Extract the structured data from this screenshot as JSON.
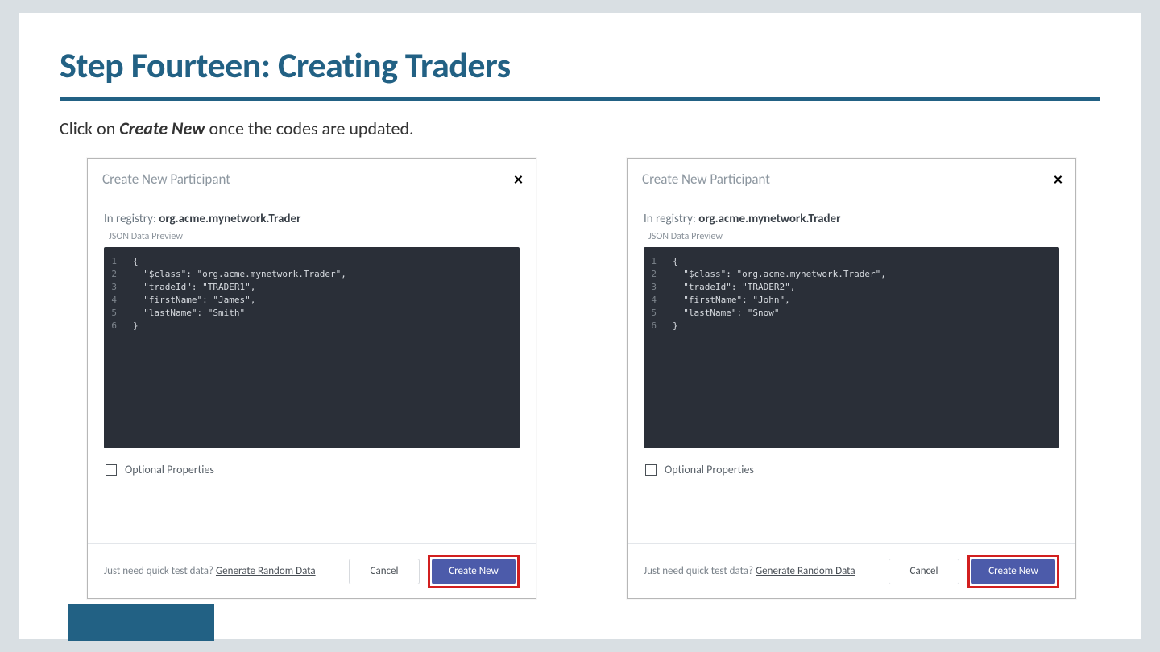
{
  "slide": {
    "title": "Step Fourteen: Creating Traders",
    "instruction_prefix": "Click on ",
    "instruction_bold": "Create New",
    "instruction_suffix": " once the codes are updated."
  },
  "dialog_shared": {
    "title": "Create New Participant",
    "registry_prefix": "In registry: ",
    "registry_name": "org.acme.mynetwork.Trader",
    "json_preview_label": "JSON Data Preview",
    "optional_label": "Optional Properties",
    "quick_prefix": "Just need quick test data? ",
    "generate_link": "Generate Random Data",
    "cancel_label": "Cancel",
    "create_label": "Create New"
  },
  "dialogs": [
    {
      "code": [
        "{",
        "  \"$class\": \"org.acme.mynetwork.Trader\",",
        "  \"tradeId\": \"TRADER1\",",
        "  \"firstName\": \"James\",",
        "  \"lastName\": \"Smith\"",
        "}"
      ]
    },
    {
      "code": [
        "{",
        "  \"$class\": \"org.acme.mynetwork.Trader\",",
        "  \"tradeId\": \"TRADER2\",",
        "  \"firstName\": \"John\",",
        "  \"lastName\": \"Snow\"",
        "}"
      ]
    }
  ]
}
